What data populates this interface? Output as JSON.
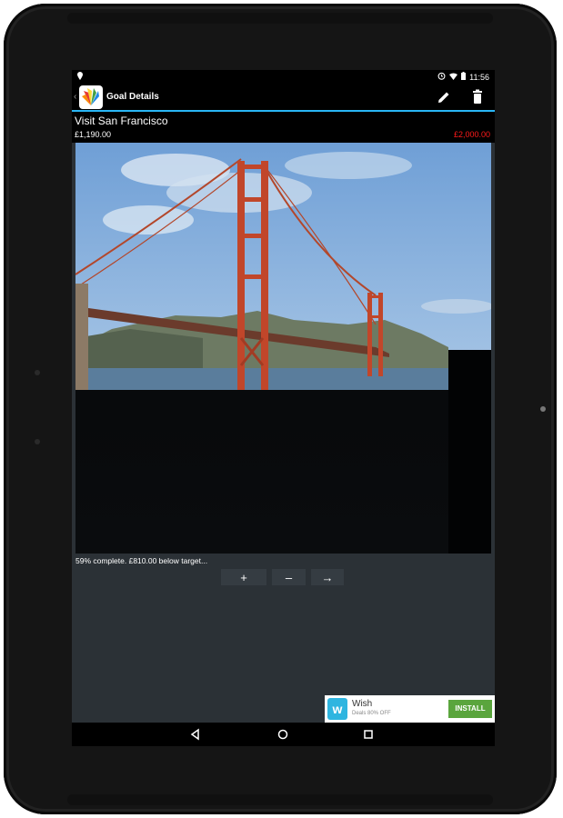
{
  "status_bar": {
    "time": "11:56",
    "icons": [
      "location-pin-icon",
      "alarm-icon",
      "wifi-icon",
      "battery-icon"
    ]
  },
  "action_bar": {
    "title": "Goal Details",
    "icons": [
      "back-icon",
      "app-icon",
      "edit-icon",
      "delete-icon"
    ]
  },
  "goal": {
    "title": "Visit San Francisco",
    "current_amount": "£1,190.00",
    "target_amount": "£2,000.00",
    "progress_fraction": 0.59,
    "progress_text": "59% complete. £810.00 below target..."
  },
  "buttons": {
    "increase_label": "+",
    "decrease_label": "–",
    "next_label": "→"
  },
  "ad": {
    "logo_letter": "w",
    "title": "Wish",
    "subtitle": "Deals 80% OFF",
    "install_label": "INSTALL"
  },
  "colors": {
    "accent": "#29b6f6",
    "target_red": "#ff1a1a",
    "install_green": "#5aa53d"
  }
}
